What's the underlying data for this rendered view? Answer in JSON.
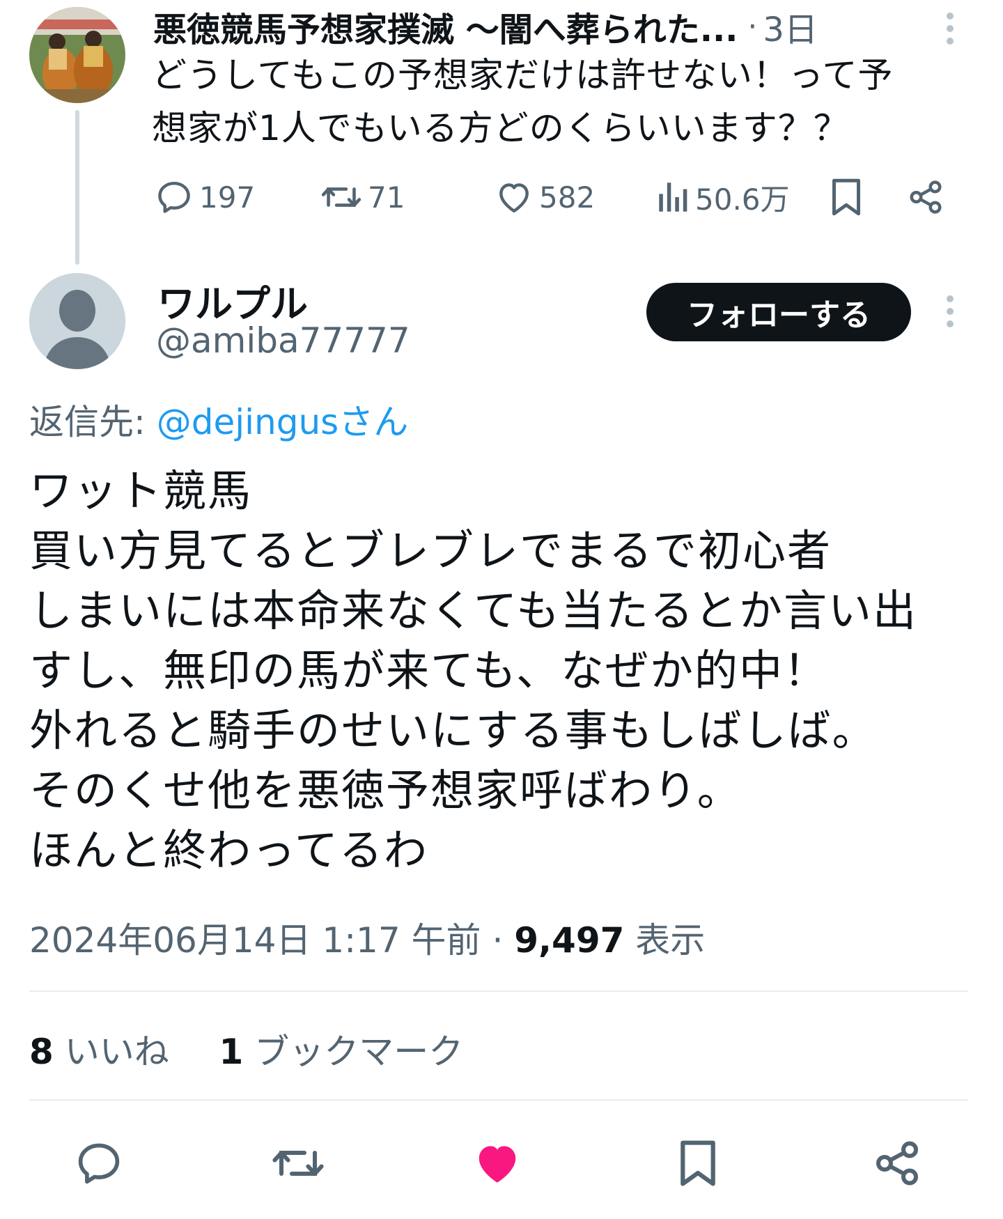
{
  "parent_tweet": {
    "author_name": "悪徳競馬予想家撲滅 〜闇へ葬られた...",
    "separator": "·",
    "time": "3日",
    "text_lines": [
      "どうしてもこの予想家だけは許せない！って予",
      "想家が1人でもいる方どのくらいいます？？"
    ],
    "replies": "197",
    "retweets": "71",
    "likes": "582",
    "views": "50.6万"
  },
  "tweet": {
    "display_name": "ワルプル",
    "handle": "@amiba77777",
    "follow_label": "フォローする",
    "reply_prefix": "返信先: ",
    "reply_target": "@dejingusさん",
    "body_lines": [
      "ワット競馬",
      "買い方見てるとブレブレでまるで初心者",
      "しまいには本命来なくても当たるとか言い出",
      "すし、無印の馬が来ても、なぜか的中！",
      "外れると騎手のせいにする事もしばしば。",
      "そのくせ他を悪徳予想家呼ばわり。",
      "ほんと終わってるわ"
    ],
    "timestamp": "2024年06月14日 1:17 午前",
    "separator": " · ",
    "view_count": "9,497",
    "view_label": " 表示",
    "likes_count": "8",
    "likes_label": " いいね",
    "bookmarks_count": "1",
    "bookmarks_label": " ブックマーク",
    "liked": true
  },
  "colors": {
    "text": "#0f1419",
    "secondary": "#536471",
    "link": "#1d9bf0",
    "like_active": "#f91880",
    "follow_bg": "#0f1419",
    "divider": "#e6ecf0"
  },
  "icons": {
    "reply": "speech-bubble-icon",
    "retweet": "retweet-arrows-icon",
    "like": "heart-icon",
    "views": "bar-chart-icon",
    "bookmark": "bookmark-icon",
    "share": "share-nodes-icon",
    "more": "vertical-dots-icon"
  }
}
